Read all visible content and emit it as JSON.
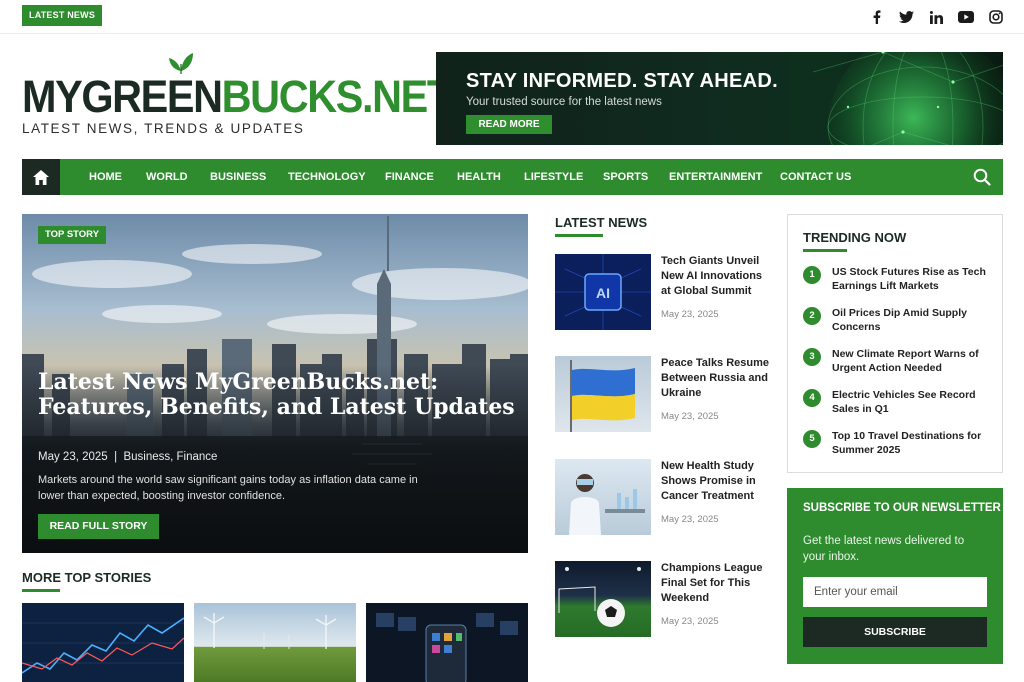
{
  "topbar": {
    "tag_label": "LATEST NEWS",
    "socials": [
      "facebook-icon",
      "twitter-icon",
      "linkedin-icon",
      "youtube-icon",
      "instagram-icon"
    ]
  },
  "logo": {
    "part1": "MYGREEN",
    "part2": "BUCKS.NET",
    "tagline": "LATEST NEWS, TRENDS & UPDATES"
  },
  "banner": {
    "title": "STAY INFORMED. STAY AHEAD.",
    "subtitle": "Your trusted source for the latest news",
    "button": "READ MORE"
  },
  "nav": {
    "items": [
      "HOME",
      "WORLD",
      "BUSINESS",
      "TECHNOLOGY",
      "FINANCE",
      "HEALTH",
      "LIFESTYLE",
      "SPORTS",
      "ENTERTAINMENT",
      "CONTACT US"
    ]
  },
  "hero": {
    "tag": "TOP STORY",
    "title": "Latest News MyGreenBucks.net: Features, Benefits, and Latest Updates",
    "date": "May 23, 2025",
    "separator": "|",
    "categories": "Business, Finance",
    "description": "Markets around the world saw significant gains today as inflation data came in lower than expected, boosting investor confidence.",
    "button": "READ FULL STORY"
  },
  "more_top_stories": {
    "title": "MORE TOP STORIES"
  },
  "latest_news": {
    "title": "LATEST NEWS",
    "items": [
      {
        "title": "Tech Giants Unveil New AI Innovations at Global Summit",
        "date": "May 23, 2025",
        "badge": "AI"
      },
      {
        "title": "Peace Talks Resume Between Russia and Ukraine",
        "date": "May 23, 2025"
      },
      {
        "title": "New Health Study Shows Promise in Cancer Treatment",
        "date": "May 23, 2025"
      },
      {
        "title": "Champions League Final Set for This Weekend",
        "date": "May 23, 2025"
      }
    ]
  },
  "trending": {
    "title": "TRENDING NOW",
    "items": [
      {
        "num": "1",
        "text": "US Stock Futures Rise as Tech Earnings Lift Markets"
      },
      {
        "num": "2",
        "text": "Oil Prices Dip Amid Supply Concerns"
      },
      {
        "num": "3",
        "text": "New Climate Report Warns of Urgent Action Needed"
      },
      {
        "num": "4",
        "text": "Electric Vehicles See Record Sales in Q1"
      },
      {
        "num": "5",
        "text": "Top 10 Travel Destinations for Summer 2025"
      }
    ]
  },
  "newsletter": {
    "title": "SUBSCRIBE TO OUR NEWSLETTER",
    "text": "Get the latest news delivered to your inbox.",
    "placeholder": "Enter your email",
    "button": "SUBSCRIBE"
  },
  "colors": {
    "brand_green": "#2e8b2e",
    "dark": "#1d2a23"
  }
}
